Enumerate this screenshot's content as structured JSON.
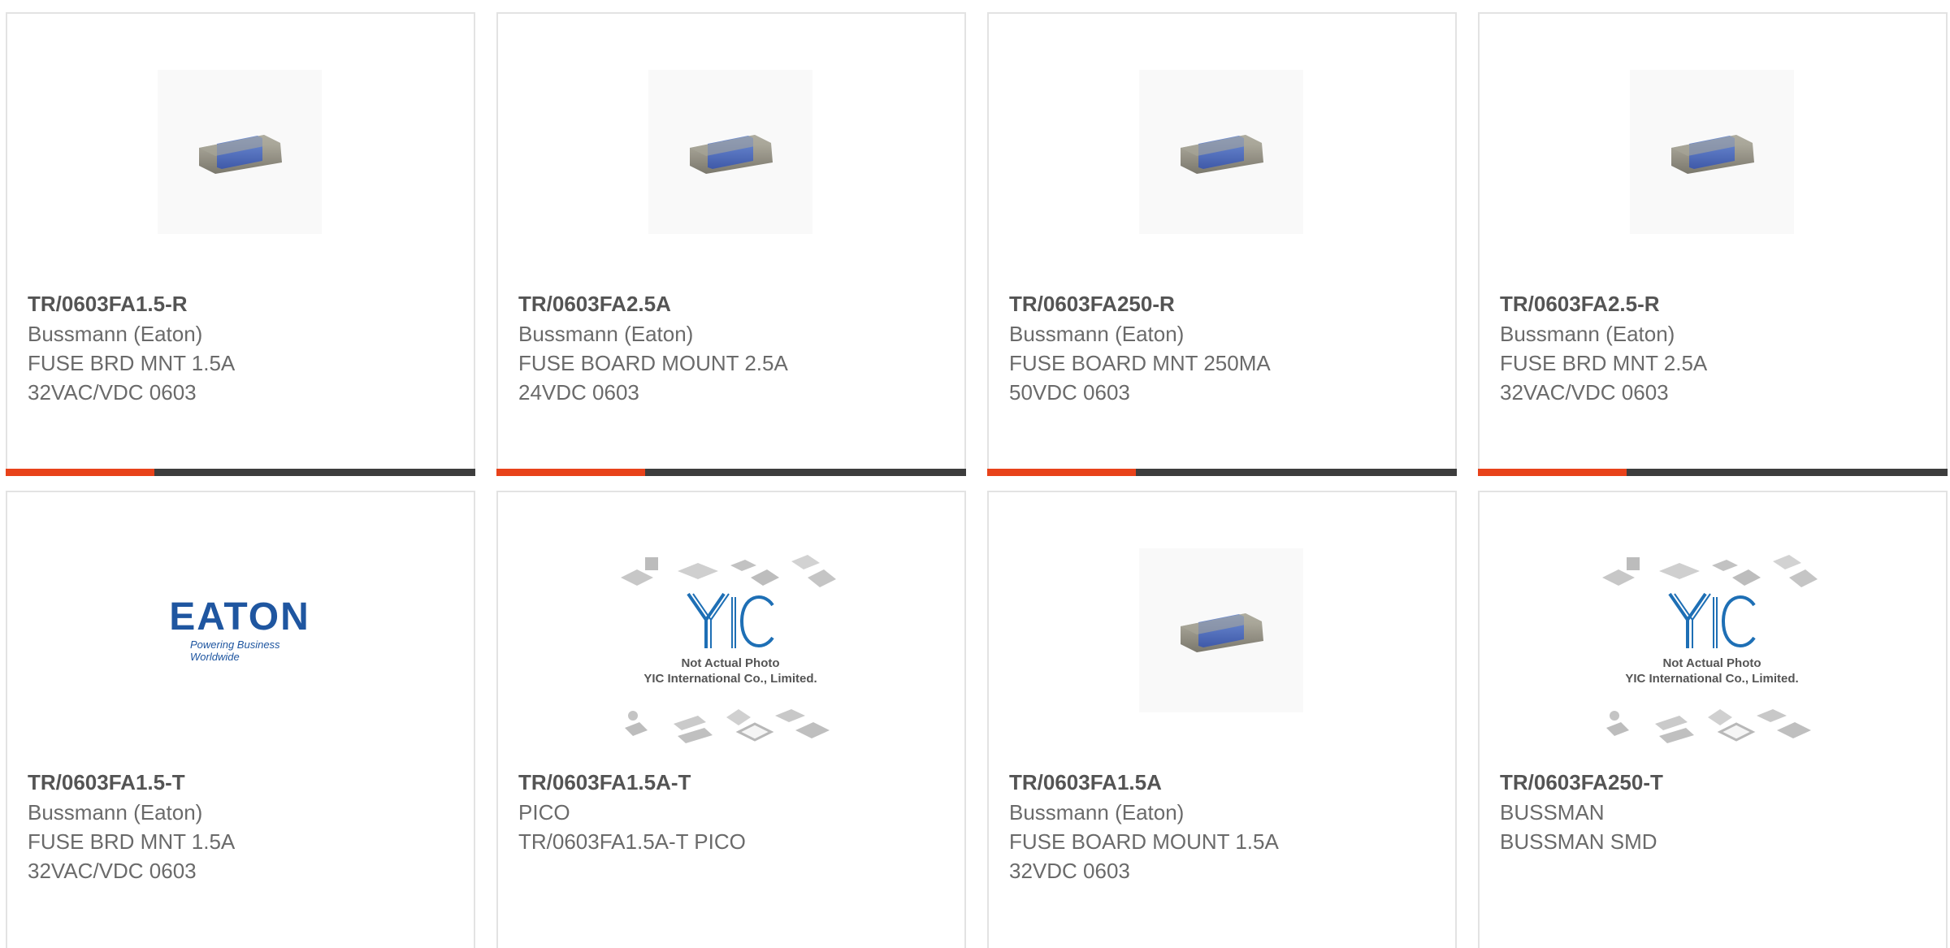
{
  "products": [
    {
      "part_number": "TR/0603FA1.5-R",
      "manufacturer": "Bussmann (Eaton)",
      "desc_line1": "FUSE BRD MNT 1.5A",
      "desc_line2": "32VAC/VDC 0603",
      "image": "fuse-chip-icon"
    },
    {
      "part_number": "TR/0603FA2.5A",
      "manufacturer": "Bussmann (Eaton)",
      "desc_line1": "FUSE BOARD MOUNT 2.5A",
      "desc_line2": "24VDC 0603",
      "image": "fuse-chip-icon"
    },
    {
      "part_number": "TR/0603FA250-R",
      "manufacturer": "Bussmann (Eaton)",
      "desc_line1": "FUSE BOARD MNT 250MA",
      "desc_line2": "50VDC 0603",
      "image": "fuse-chip-icon"
    },
    {
      "part_number": "TR/0603FA2.5-R",
      "manufacturer": "Bussmann (Eaton)",
      "desc_line1": "FUSE BRD MNT 2.5A",
      "desc_line2": "32VAC/VDC 0603",
      "image": "fuse-chip-icon"
    },
    {
      "part_number": "TR/0603FA1.5-T",
      "manufacturer": "Bussmann (Eaton)",
      "desc_line1": "FUSE BRD MNT 1.5A",
      "desc_line2": "32VAC/VDC 0603",
      "image": "eaton-logo",
      "logo_word": "EATON",
      "logo_tagline": "Powering Business Worldwide"
    },
    {
      "part_number": "TR/0603FA1.5A-T",
      "manufacturer": "PICO",
      "desc_line1": "TR/0603FA1.5A-T PICO",
      "desc_line2": "",
      "image": "yic-placeholder",
      "placeholder_line1": "Not Actual Photo",
      "placeholder_line2": "YIC International Co., Limited.",
      "placeholder_logo": "YIC"
    },
    {
      "part_number": "TR/0603FA1.5A",
      "manufacturer": "Bussmann (Eaton)",
      "desc_line1": "FUSE BOARD MOUNT 1.5A",
      "desc_line2": "32VDC 0603",
      "image": "fuse-chip-icon"
    },
    {
      "part_number": "TR/0603FA250-T",
      "manufacturer": "BUSSMAN",
      "desc_line1": "BUSSMAN SMD",
      "desc_line2": "",
      "image": "yic-placeholder",
      "placeholder_line1": "Not Actual Photo",
      "placeholder_line2": "YIC International Co., Limited.",
      "placeholder_logo": "YIC"
    }
  ],
  "colors": {
    "accent": "#e8421a",
    "bar": "#3d3d3d",
    "border": "#e3e3e3",
    "eaton_blue": "#1f56a0",
    "yic_blue": "#1e6fb5"
  }
}
